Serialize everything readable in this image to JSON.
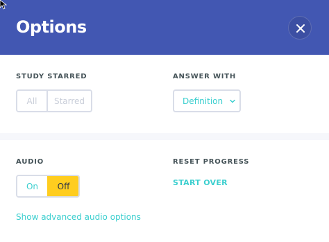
{
  "header": {
    "title": "Options",
    "close_icon": "close-icon"
  },
  "study_starred": {
    "label": "STUDY STARRED",
    "options": [
      "All",
      "Starred"
    ],
    "enabled": false
  },
  "answer_with": {
    "label": "ANSWER WITH",
    "selected": "Definition",
    "icon": "chevron-down-icon"
  },
  "audio": {
    "label": "AUDIO",
    "on_label": "On",
    "off_label": "Off",
    "selected": "Off",
    "advanced_link": "Show advanced audio options"
  },
  "reset_progress": {
    "label": "RESET PROGRESS",
    "action": "START OVER"
  },
  "colors": {
    "header_bg": "#4257b2",
    "accent": "#3ccfcf",
    "selected_toggle": "#ffcd1f",
    "border": "#d9dde8"
  }
}
